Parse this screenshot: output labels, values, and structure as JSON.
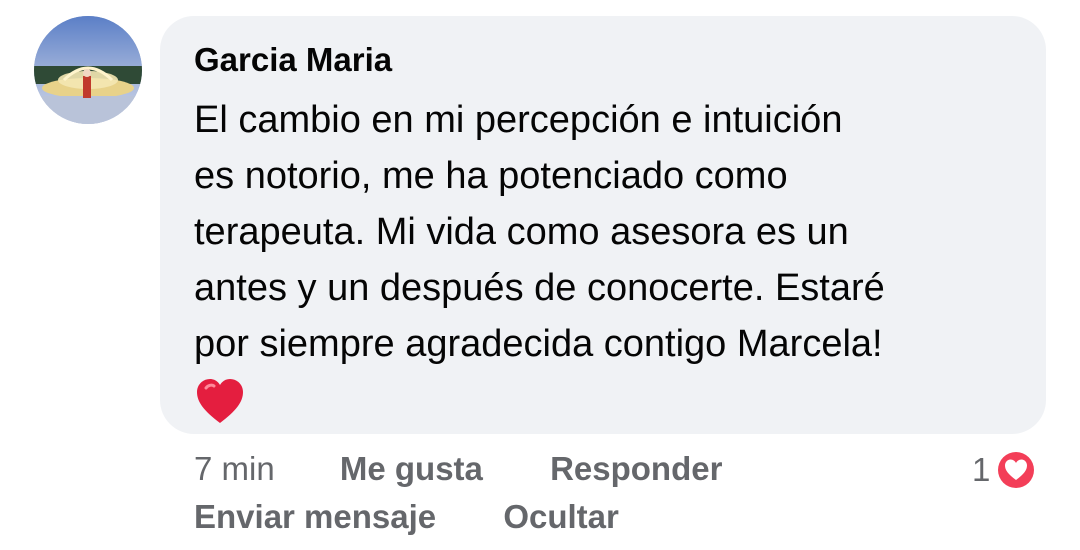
{
  "comment": {
    "author": "Garcia Maria",
    "lines": [
      "El cambio en mi percepción e intuición",
      "es notorio, me ha potenciado como",
      "terapeuta. Mi vida como asesora es un",
      "antes y un después de conocerte. Estaré",
      "por siempre agradecida contigo Marcela!"
    ],
    "emoji": "heart-emoji",
    "time": "7 min",
    "like_label": "Me gusta",
    "reply_label": "Responder",
    "send_message_label": "Enviar mensaje",
    "hide_label": "Ocultar",
    "reaction_count": "1",
    "reaction_icon": "love-reaction-icon"
  },
  "colors": {
    "bubble": "#f0f2f5",
    "text": "#050505",
    "secondary": "#65676b",
    "heart": "#e41e3f"
  }
}
